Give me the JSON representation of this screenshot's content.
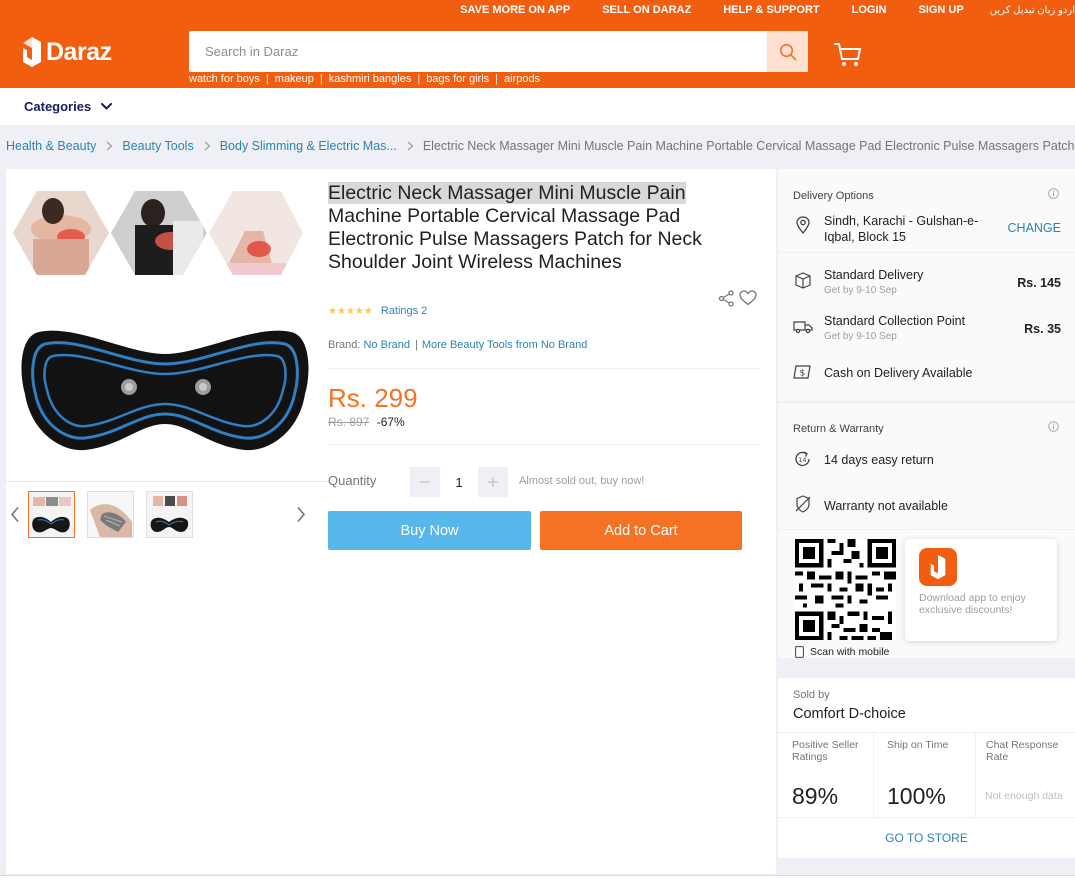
{
  "header": {
    "topbar_links": [
      "SAVE MORE ON APP",
      "SELL ON DARAZ",
      "HELP & SUPPORT",
      "LOGIN",
      "SIGN UP"
    ],
    "language_switch": "اردو زبان تبدیل کریں",
    "logo_text": "Daraz",
    "search_placeholder": "Search in Daraz",
    "search_value": "",
    "suggestions": [
      "watch for boys",
      "makeup",
      "kashmiri bangles",
      "bags for girls",
      "airpods"
    ],
    "brand_color": "#f15e0f"
  },
  "nav": {
    "categories_label": "Categories"
  },
  "breadcrumb": {
    "items": [
      "Health & Beauty",
      "Beauty Tools",
      "Body Slimming & Electric Mas..."
    ],
    "current": "Electric Neck Massager Mini Muscle Pain Machine Portable Cervical Massage Pad Electronic Pulse Massagers Patch"
  },
  "product": {
    "title_highlight": "Electric Neck Massager Mini Muscle Pain",
    "title_rest": " Machine Portable Cervical Massage Pad Electronic Pulse Massagers Patch for Neck Shoulder Joint Wireless Machines",
    "stars": "★★★★★",
    "rating_value": 5,
    "ratings_text": "Ratings 2",
    "brand_label": "Brand:",
    "brand_name": "No Brand",
    "more_from_brand": "More Beauty Tools from No Brand",
    "price": "Rs. 299",
    "original_price": "Rs. 897",
    "discount": "-67%",
    "quantity_label": "Quantity",
    "quantity": "1",
    "stock_note": "Almost sold out, buy now!",
    "buy_now_label": "Buy Now",
    "add_to_cart_label": "Add to Cart",
    "price_color": "#f57224"
  },
  "delivery": {
    "title": "Delivery Options",
    "location": "Sindh, Karachi - Gulshan-e-Iqbal, Block 15",
    "change_label": "CHANGE",
    "options": [
      {
        "name": "Standard Delivery",
        "eta": "Get by 9-10 Sep",
        "fee": "Rs. 145"
      },
      {
        "name": "Standard Collection Point",
        "eta": "Get by 9-10 Sep",
        "fee": "Rs. 35"
      }
    ],
    "cod": "Cash on Delivery Available"
  },
  "warranty": {
    "title": "Return & Warranty",
    "return_text": "14 days easy return",
    "warranty_text": "Warranty not available"
  },
  "app_promo": {
    "scan_text": "Scan with mobile",
    "download_text": "Download app to enjoy exclusive discounts!"
  },
  "seller": {
    "sold_by_label": "Sold by",
    "name": "Comfort D-choice",
    "metrics": [
      {
        "label": "Positive Seller Ratings",
        "value": "89%"
      },
      {
        "label": "Ship on Time",
        "value": "100%"
      },
      {
        "label": "Chat Response Rate",
        "value": "Not enough data"
      }
    ],
    "go_to_store_label": "GO TO STORE"
  }
}
